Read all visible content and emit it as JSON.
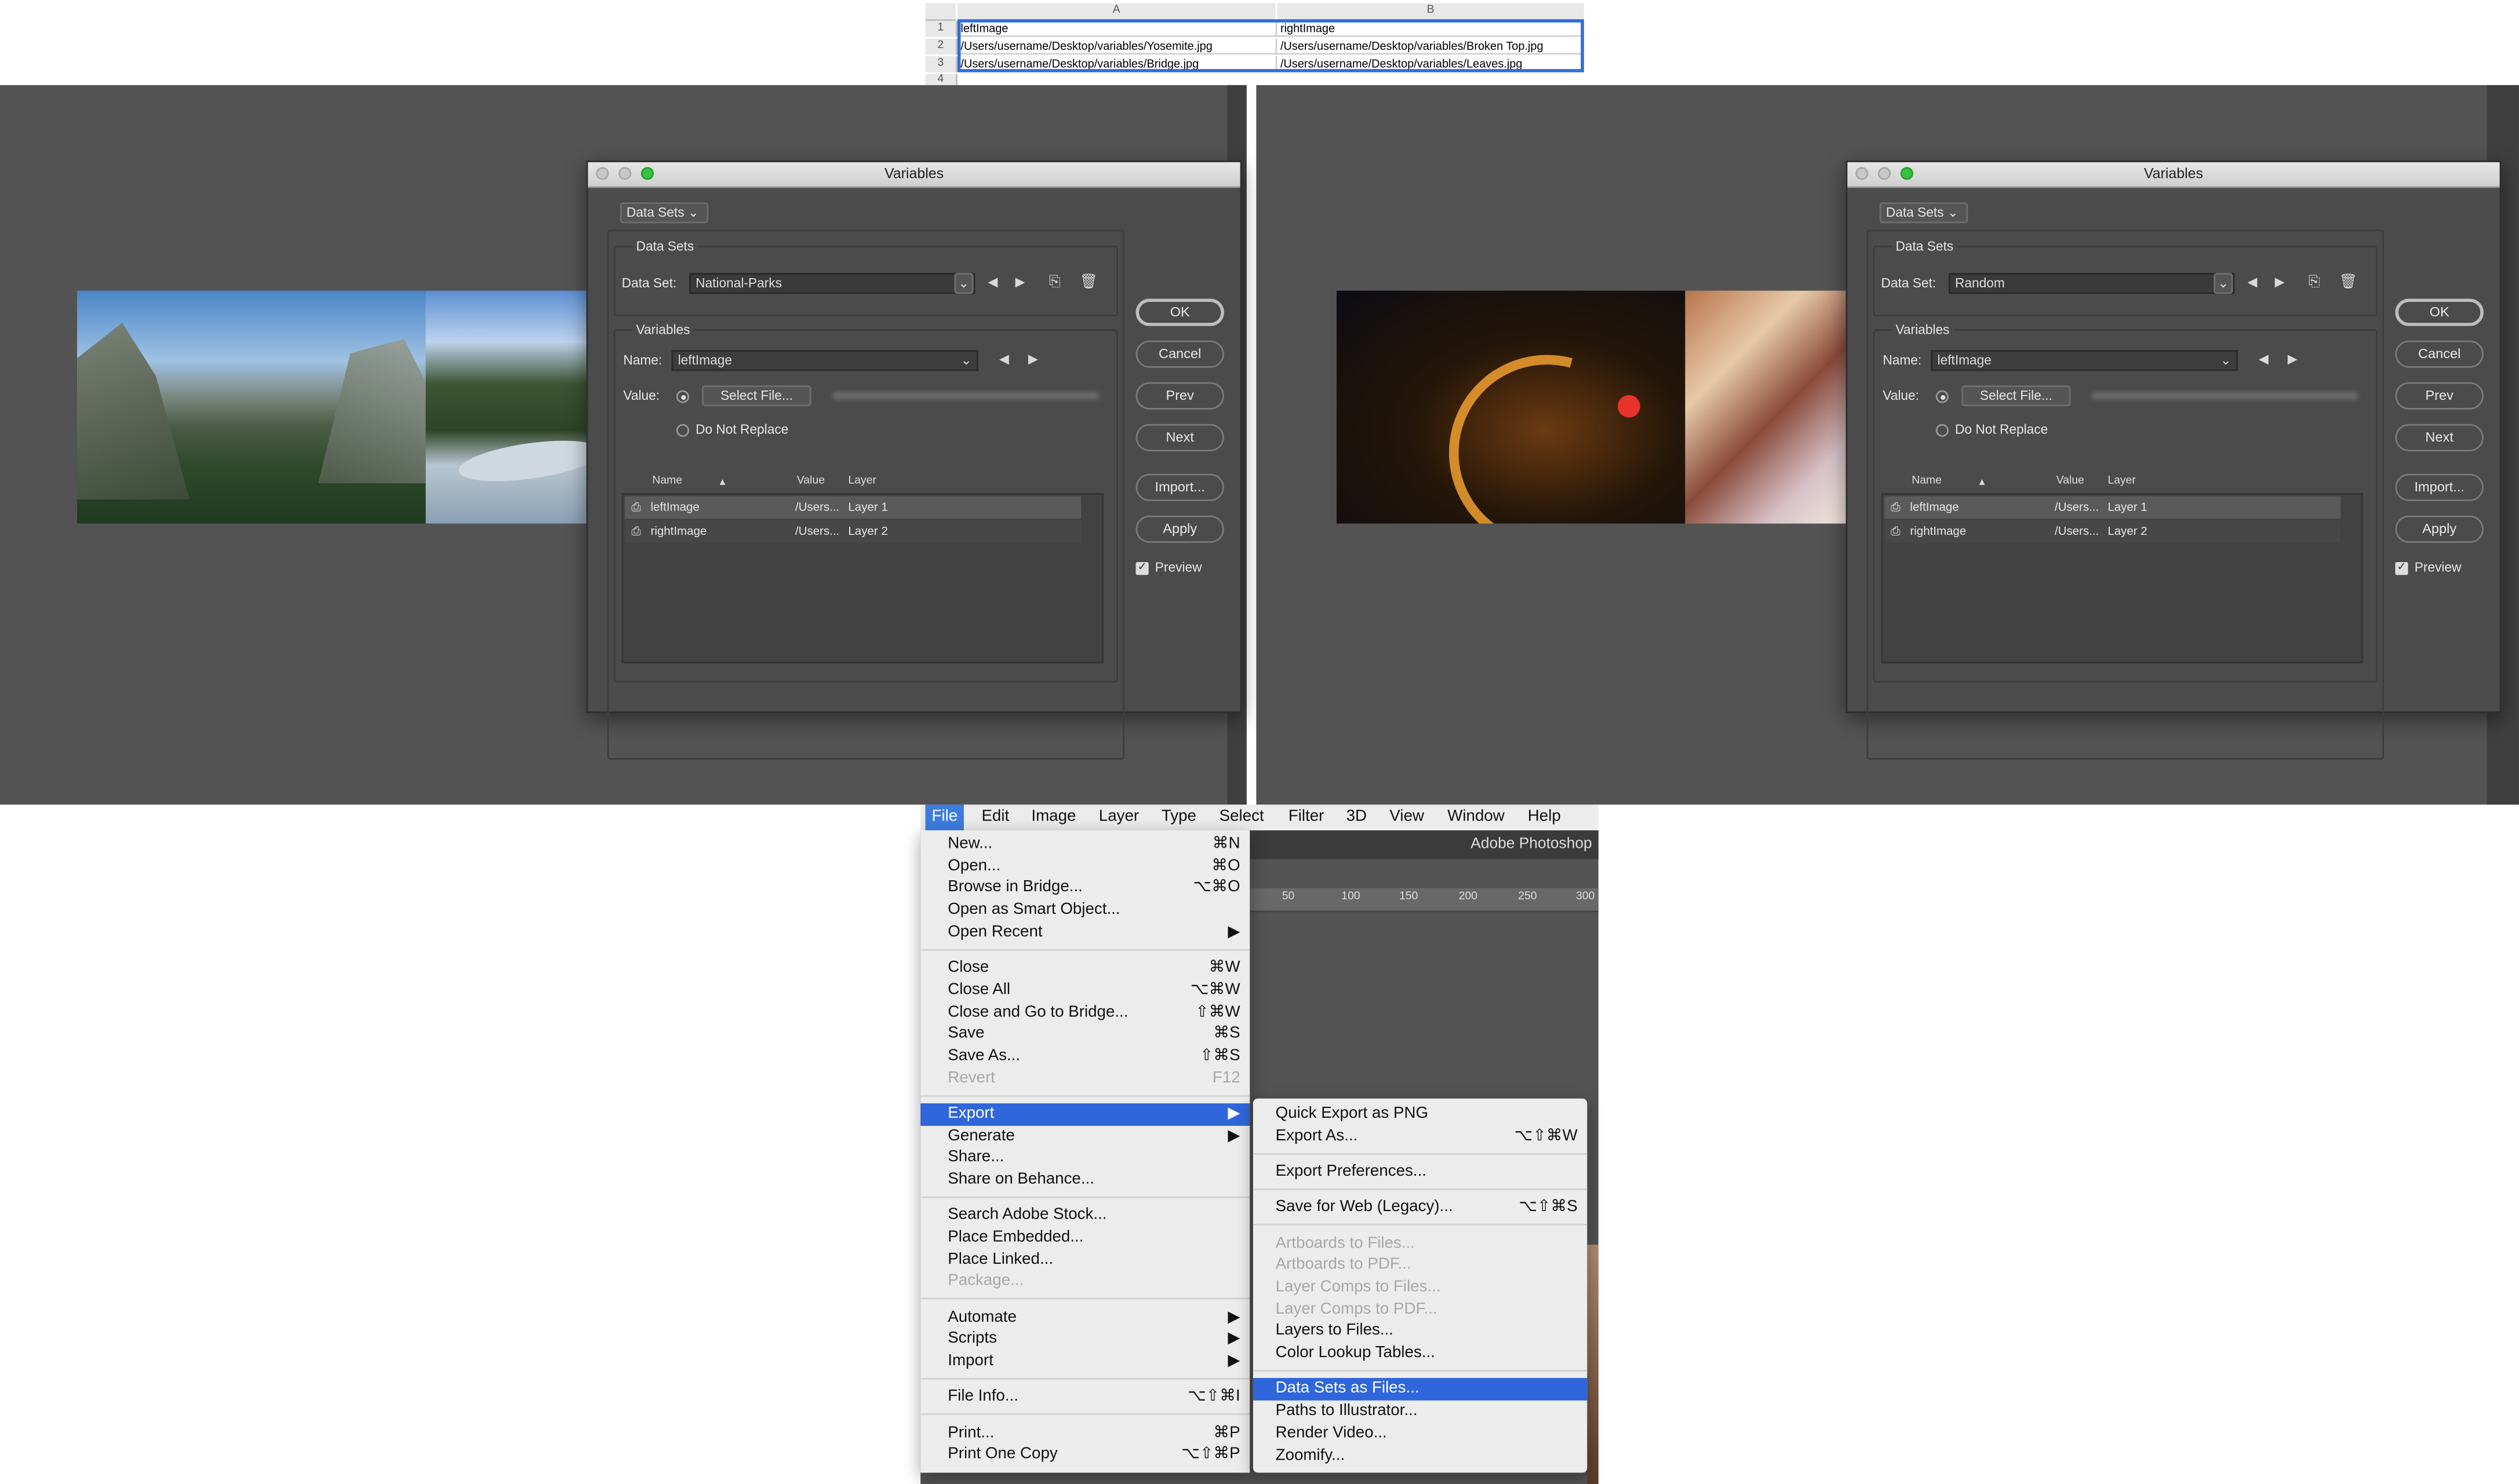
{
  "spreadsheet": {
    "columns": [
      "A",
      "B"
    ],
    "row_numbers": [
      "1",
      "2",
      "3",
      "4"
    ],
    "rows": [
      [
        "leftImage",
        "rightImage"
      ],
      [
        "/Users/username/Desktop/variables/Yosemite.jpg",
        "/Users/username/Desktop/variables/Broken Top.jpg"
      ],
      [
        "/Users/username/Desktop/variables/Bridge.jpg",
        "/Users/username/Desktop/variables/Leaves.jpg"
      ]
    ]
  },
  "dialogs": [
    {
      "window_title": "Variables",
      "mode_select": "Data Sets",
      "data_sets_heading": "Data Sets",
      "data_set_label": "Data Set:",
      "data_set_value": "National-Parks",
      "variables_heading": "Variables",
      "name_label": "Name:",
      "name_value": "leftImage",
      "value_label": "Value:",
      "select_file": "Select File...",
      "do_not_replace": "Do Not Replace",
      "table_headers": [
        "Name",
        "Value",
        "Layer"
      ],
      "table_rows": [
        {
          "name": "leftImage",
          "value": "/Users...",
          "layer": "Layer 1"
        },
        {
          "name": "rightImage",
          "value": "/Users...",
          "layer": "Layer 2"
        }
      ],
      "buttons": {
        "ok": "OK",
        "cancel": "Cancel",
        "prev": "Prev",
        "next": "Next",
        "import": "Import...",
        "apply": "Apply"
      },
      "preview_label": "Preview",
      "preview_checked": true,
      "canvas_images": [
        "Yosemite valley",
        "Broken Top creek"
      ]
    },
    {
      "window_title": "Variables",
      "mode_select": "Data Sets",
      "data_sets_heading": "Data Sets",
      "data_set_label": "Data Set:",
      "data_set_value": "Random",
      "variables_heading": "Variables",
      "name_label": "Name:",
      "name_value": "leftImage",
      "value_label": "Value:",
      "select_file": "Select File...",
      "do_not_replace": "Do Not Replace",
      "table_headers": [
        "Name",
        "Value",
        "Layer"
      ],
      "table_rows": [
        {
          "name": "leftImage",
          "value": "/Users...",
          "layer": "Layer 1"
        },
        {
          "name": "rightImage",
          "value": "/Users...",
          "layer": "Layer 2"
        }
      ],
      "buttons": {
        "ok": "OK",
        "cancel": "Cancel",
        "prev": "Prev",
        "next": "Next",
        "import": "Import...",
        "apply": "Apply"
      },
      "preview_label": "Preview",
      "preview_checked": true,
      "canvas_images": [
        "Bridge at night",
        "Autumn leaves"
      ]
    }
  ],
  "menubar": {
    "items": [
      "File",
      "Edit",
      "Image",
      "Layer",
      "Type",
      "Select",
      "Filter",
      "3D",
      "View",
      "Window",
      "Help"
    ],
    "active": "File",
    "app_title": "Adobe Photoshop",
    "ruler_ticks": [
      "50",
      "100",
      "150",
      "200",
      "250",
      "300"
    ]
  },
  "file_menu": [
    {
      "label": "New...",
      "shortcut": "⌘N"
    },
    {
      "label": "Open...",
      "shortcut": "⌘O"
    },
    {
      "label": "Browse in Bridge...",
      "shortcut": "⌥⌘O"
    },
    {
      "label": "Open as Smart Object...",
      "shortcut": ""
    },
    {
      "label": "Open Recent",
      "shortcut": "▶"
    },
    {
      "separator": true
    },
    {
      "label": "Close",
      "shortcut": "⌘W"
    },
    {
      "label": "Close All",
      "shortcut": "⌥⌘W"
    },
    {
      "label": "Close and Go to Bridge...",
      "shortcut": "⇧⌘W"
    },
    {
      "label": "Save",
      "shortcut": "⌘S"
    },
    {
      "label": "Save As...",
      "shortcut": "⇧⌘S"
    },
    {
      "label": "Revert",
      "shortcut": "F12",
      "disabled": true
    },
    {
      "separator": true
    },
    {
      "label": "Export",
      "shortcut": "▶",
      "highlighted": true
    },
    {
      "label": "Generate",
      "shortcut": "▶"
    },
    {
      "label": "Share...",
      "shortcut": ""
    },
    {
      "label": "Share on Behance...",
      "shortcut": ""
    },
    {
      "separator": true
    },
    {
      "label": "Search Adobe Stock...",
      "shortcut": ""
    },
    {
      "label": "Place Embedded...",
      "shortcut": ""
    },
    {
      "label": "Place Linked...",
      "shortcut": ""
    },
    {
      "label": "Package...",
      "shortcut": "",
      "disabled": true
    },
    {
      "separator": true
    },
    {
      "label": "Automate",
      "shortcut": "▶"
    },
    {
      "label": "Scripts",
      "shortcut": "▶"
    },
    {
      "label": "Import",
      "shortcut": "▶"
    },
    {
      "separator": true
    },
    {
      "label": "File Info...",
      "shortcut": "⌥⇧⌘I"
    },
    {
      "separator": true
    },
    {
      "label": "Print...",
      "shortcut": "⌘P"
    },
    {
      "label": "Print One Copy",
      "shortcut": "⌥⇧⌘P"
    }
  ],
  "export_menu": [
    {
      "label": "Quick Export as PNG",
      "shortcut": ""
    },
    {
      "label": "Export As...",
      "shortcut": "⌥⇧⌘W"
    },
    {
      "separator": true
    },
    {
      "label": "Export Preferences...",
      "shortcut": ""
    },
    {
      "separator": true
    },
    {
      "label": "Save for Web (Legacy)...",
      "shortcut": "⌥⇧⌘S"
    },
    {
      "separator": true
    },
    {
      "label": "Artboards to Files...",
      "shortcut": "",
      "disabled": true
    },
    {
      "label": "Artboards to PDF...",
      "shortcut": "",
      "disabled": true
    },
    {
      "label": "Layer Comps to Files...",
      "shortcut": "",
      "disabled": true
    },
    {
      "label": "Layer Comps to PDF...",
      "shortcut": "",
      "disabled": true
    },
    {
      "label": "Layers to Files...",
      "shortcut": ""
    },
    {
      "label": "Color Lookup Tables...",
      "shortcut": ""
    },
    {
      "separator": true
    },
    {
      "label": "Data Sets as Files...",
      "shortcut": "",
      "highlighted": true
    },
    {
      "label": "Paths to Illustrator...",
      "shortcut": ""
    },
    {
      "label": "Render Video...",
      "shortcut": ""
    },
    {
      "label": "Zoomify...",
      "shortcut": ""
    }
  ],
  "colors": {
    "accent": "#2f66db",
    "dialog_bg": "#4b4b4b",
    "workspace": "#535353"
  }
}
